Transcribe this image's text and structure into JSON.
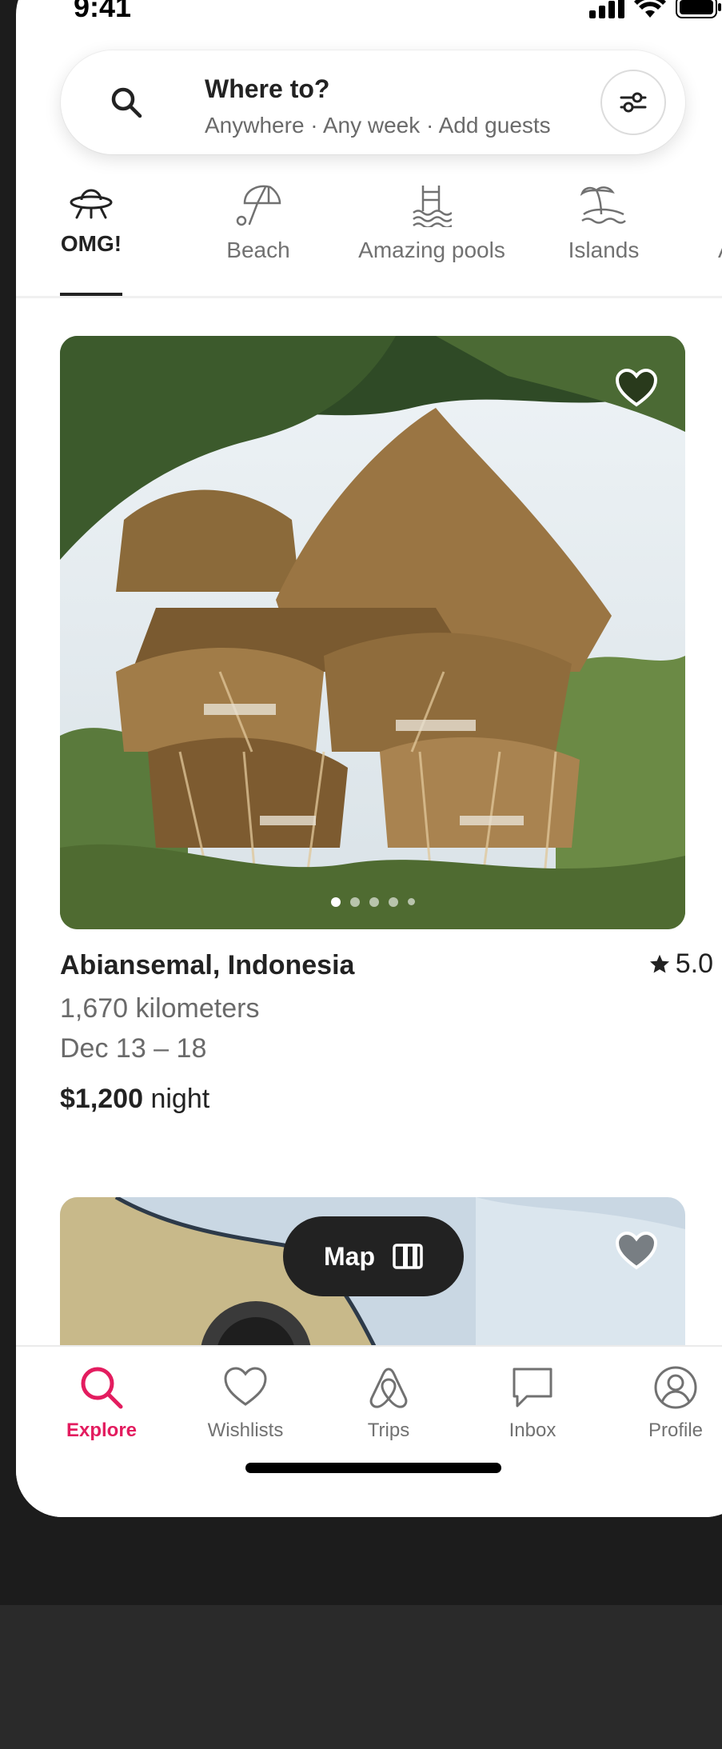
{
  "status_bar": {
    "time": "9:41"
  },
  "search": {
    "title": "Where to?",
    "subtitle": "Anywhere · Any week · Add guests"
  },
  "categories": [
    {
      "label": "OMG!",
      "icon": "ufo-icon",
      "active": true
    },
    {
      "label": "Beach",
      "icon": "umbrella-icon",
      "active": false
    },
    {
      "label": "Amazing pools",
      "icon": "pool-icon",
      "active": false
    },
    {
      "label": "Islands",
      "icon": "island-icon",
      "active": false
    },
    {
      "label": "A",
      "icon": "partial-category-icon",
      "active": false
    }
  ],
  "listing": {
    "location": "Abiansemal, Indonesia",
    "rating": "5.0",
    "distance": "1,670 kilometers",
    "dates": "Dec 13 – 18",
    "price": "$1,200",
    "price_unit": "night",
    "photo_count": 5,
    "active_photo": 1
  },
  "map_button": {
    "label": "Map"
  },
  "tabs": [
    {
      "label": "Explore",
      "icon": "search-icon",
      "active": true
    },
    {
      "label": "Wishlists",
      "icon": "heart-icon",
      "active": false
    },
    {
      "label": "Trips",
      "icon": "airbnb-logo-icon",
      "active": false
    },
    {
      "label": "Inbox",
      "icon": "message-icon",
      "active": false
    },
    {
      "label": "Profile",
      "icon": "profile-icon",
      "active": false
    }
  ],
  "colors": {
    "accent": "#E31C5F",
    "text": "#222222",
    "muted": "#717171"
  }
}
